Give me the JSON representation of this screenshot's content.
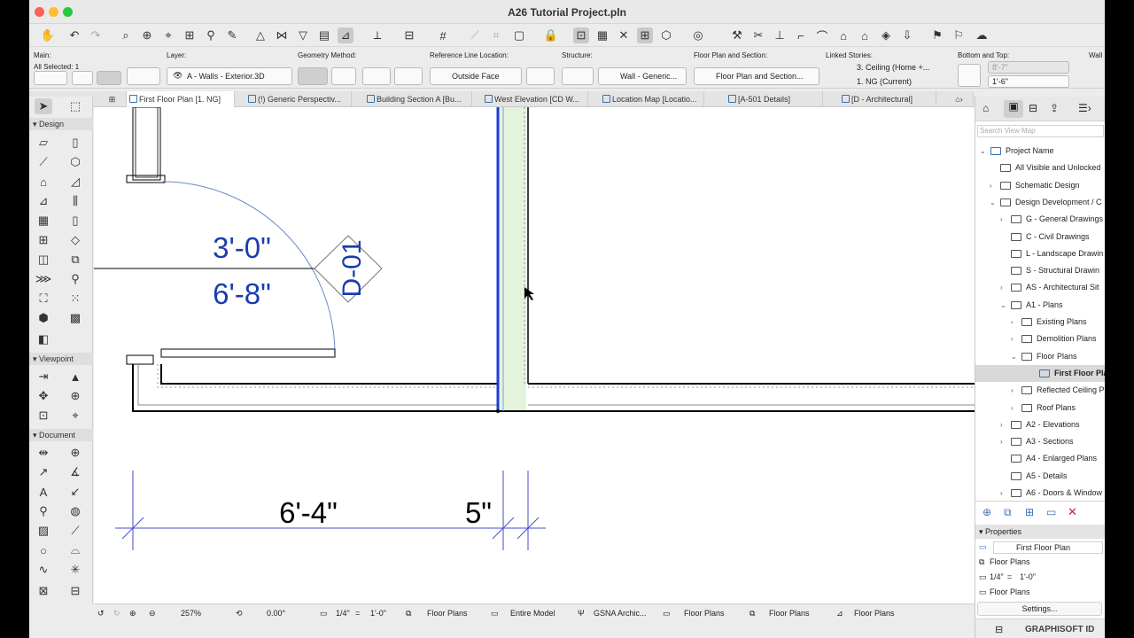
{
  "window": {
    "title": "A26 Tutorial Project.pln"
  },
  "info_box": {
    "main_label": "Main:",
    "selection": "All Selected: 1",
    "layer_label": "Layer:",
    "layer_value": "A - Walls - Exterior.3D",
    "geometry_label": "Geometry Method:",
    "refline_label": "Reference Line Location:",
    "refline_value": "Outside Face",
    "structure_label": "Structure:",
    "structure_value": "Wall - Generic...",
    "fps_label": "Floor Plan and Section:",
    "fps_value": "Floor Plan and Section...",
    "linked_label": "Linked Stories:",
    "linked_top": "3. Ceiling  (Home +...",
    "linked_bottom": "1. NG (Current)",
    "bt_label": "Bottom and Top:",
    "bt_top": "8'-7\"",
    "bt_bottom": "1'-6\"",
    "wall_label": "Wall"
  },
  "tabs": [
    {
      "label": "First Floor Plan [1. NG]"
    },
    {
      "label": "(!) Generic Perspectiv..."
    },
    {
      "label": "Building Section A [Bu..."
    },
    {
      "label": "West Elevation [CD W..."
    },
    {
      "label": "Location Map [Locatio..."
    },
    {
      "label": "[A-501 Details]"
    },
    {
      "label": "[D - Architectural]"
    }
  ],
  "toolbox": {
    "design_label": "Design",
    "viewpoint_label": "Viewpoint",
    "document_label": "Document"
  },
  "drawing": {
    "door_width": "3'-0\"",
    "door_height": "6'-8\"",
    "door_tag": "D-01",
    "dim_1": "6'-4\"",
    "dim_2": "5\""
  },
  "status": {
    "zoom": "257%",
    "angle": "0.00°",
    "scale_a": "1/4\"",
    "scale_eq": "=",
    "scale_b": "1'-0\"",
    "layer_combo": "Floor Plans",
    "model": "Entire Model",
    "pen_set": "GSNA Archic...",
    "dim_std": "Floor Plans",
    "override": "Floor Plans",
    "renovation": "Floor Plans"
  },
  "navigator": {
    "search_placeholder": "Search View Map",
    "tree": [
      {
        "label": "Project Name",
        "level": 0,
        "arrow": "⌄"
      },
      {
        "label": "All Visible and Unlocked",
        "level": 1,
        "arrow": ""
      },
      {
        "label": "Schematic Design",
        "level": 1,
        "arrow": "›"
      },
      {
        "label": "Design Development / C",
        "level": 1,
        "arrow": "⌄"
      },
      {
        "label": "G - General Drawings",
        "level": 2,
        "arrow": "›"
      },
      {
        "label": "C - Civil Drawings",
        "level": 2,
        "arrow": ""
      },
      {
        "label": "L - Landscape Drawin",
        "level": 2,
        "arrow": ""
      },
      {
        "label": "S - Structural Drawin",
        "level": 2,
        "arrow": ""
      },
      {
        "label": "AS - Architectural Sit",
        "level": 2,
        "arrow": "›"
      },
      {
        "label": "A1 - Plans",
        "level": 2,
        "arrow": "⌄"
      },
      {
        "label": "Existing Plans",
        "level": 3,
        "arrow": "›"
      },
      {
        "label": "Demolition Plans",
        "level": 3,
        "arrow": "›"
      },
      {
        "label": "Floor Plans",
        "level": 3,
        "arrow": "⌄"
      },
      {
        "label": "First Floor Plan",
        "level": 4,
        "arrow": ""
      },
      {
        "label": "Reflected Ceiling P",
        "level": 3,
        "arrow": "›"
      },
      {
        "label": "Roof Plans",
        "level": 3,
        "arrow": "›"
      },
      {
        "label": "A2 - Elevations",
        "level": 2,
        "arrow": "›"
      },
      {
        "label": "A3 - Sections",
        "level": 2,
        "arrow": "›"
      },
      {
        "label": "A4 - Enlarged Plans",
        "level": 2,
        "arrow": ""
      },
      {
        "label": "A5 - Details",
        "level": 2,
        "arrow": ""
      },
      {
        "label": "A6 - Doors & Window",
        "level": 2,
        "arrow": "›"
      }
    ],
    "properties_label": "Properties",
    "prop_name": "First Floor Plan",
    "prop_layer": "Floor Plans",
    "prop_scale_a": "1/4\"",
    "prop_scale_eq": "=",
    "prop_scale_b": "1'-0\"",
    "prop_model": "Floor Plans",
    "settings_button": "Settings...",
    "brand": "GRAPHISOFT ID"
  }
}
